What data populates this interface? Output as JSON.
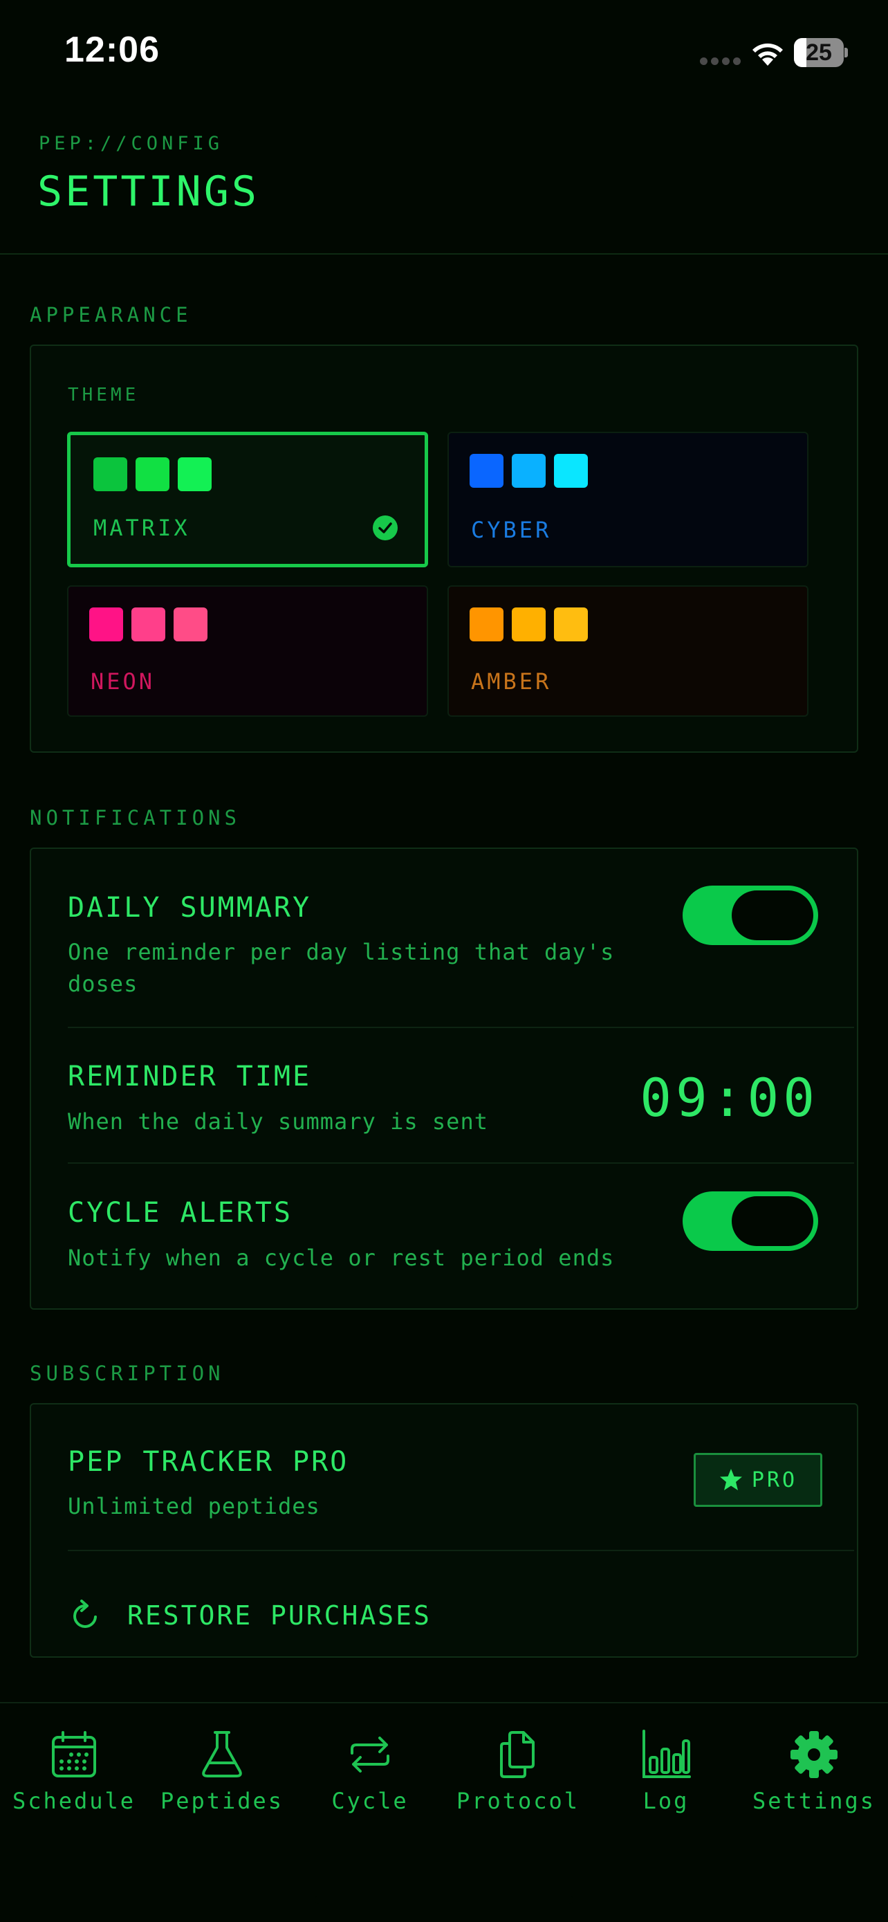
{
  "status_bar": {
    "time": "12:06",
    "battery": "25",
    "battery_level": 0.25
  },
  "header": {
    "eyebrow": "PEP://CONFIG",
    "title": "SETTINGS"
  },
  "appearance": {
    "section_title": "APPEARANCE",
    "theme_label": "THEME",
    "themes": [
      {
        "name": "MATRIX",
        "selected": true,
        "color": "#1fc352",
        "swatches": [
          "#0bc43d",
          "#11e043",
          "#13f054"
        ]
      },
      {
        "name": "CYBER",
        "selected": false,
        "color": "#1a7be0",
        "swatches": [
          "#0a66ff",
          "#0ab1ff",
          "#0ae6ff"
        ]
      },
      {
        "name": "NEON",
        "selected": false,
        "color": "#d0175e",
        "swatches": [
          "#ff1386",
          "#ff3f8a",
          "#ff4c87"
        ]
      },
      {
        "name": "AMBER",
        "selected": false,
        "color": "#c8741b",
        "swatches": [
          "#ff9500",
          "#ffb000",
          "#ffbd10"
        ]
      }
    ]
  },
  "notifications": {
    "section_title": "NOTIFICATIONS",
    "daily_summary": {
      "title": "DAILY SUMMARY",
      "description": "One reminder per day listing that day's doses",
      "enabled": true
    },
    "reminder_time": {
      "title": "REMINDER TIME",
      "description": "When the daily summary is sent",
      "value": "09:00"
    },
    "cycle_alerts": {
      "title": "CYCLE ALERTS",
      "description": "Notify when a cycle or rest period ends",
      "enabled": true
    }
  },
  "subscription": {
    "section_title": "SUBSCRIPTION",
    "plan_title": "PEP TRACKER PRO",
    "plan_description": "Unlimited peptides",
    "badge": "PRO",
    "restore_label": "RESTORE PURCHASES"
  },
  "tabs": [
    {
      "label": "Schedule",
      "icon": "calendar-icon"
    },
    {
      "label": "Peptides",
      "icon": "flask-icon"
    },
    {
      "label": "Cycle",
      "icon": "repeat-icon"
    },
    {
      "label": "Protocol",
      "icon": "documents-icon"
    },
    {
      "label": "Log",
      "icon": "bar-chart-icon"
    },
    {
      "label": "Settings",
      "icon": "gear-icon",
      "active": true
    }
  ],
  "colors": {
    "accent": "#22d95a",
    "background": "#010801",
    "toggle_on": "#0ac94a"
  }
}
